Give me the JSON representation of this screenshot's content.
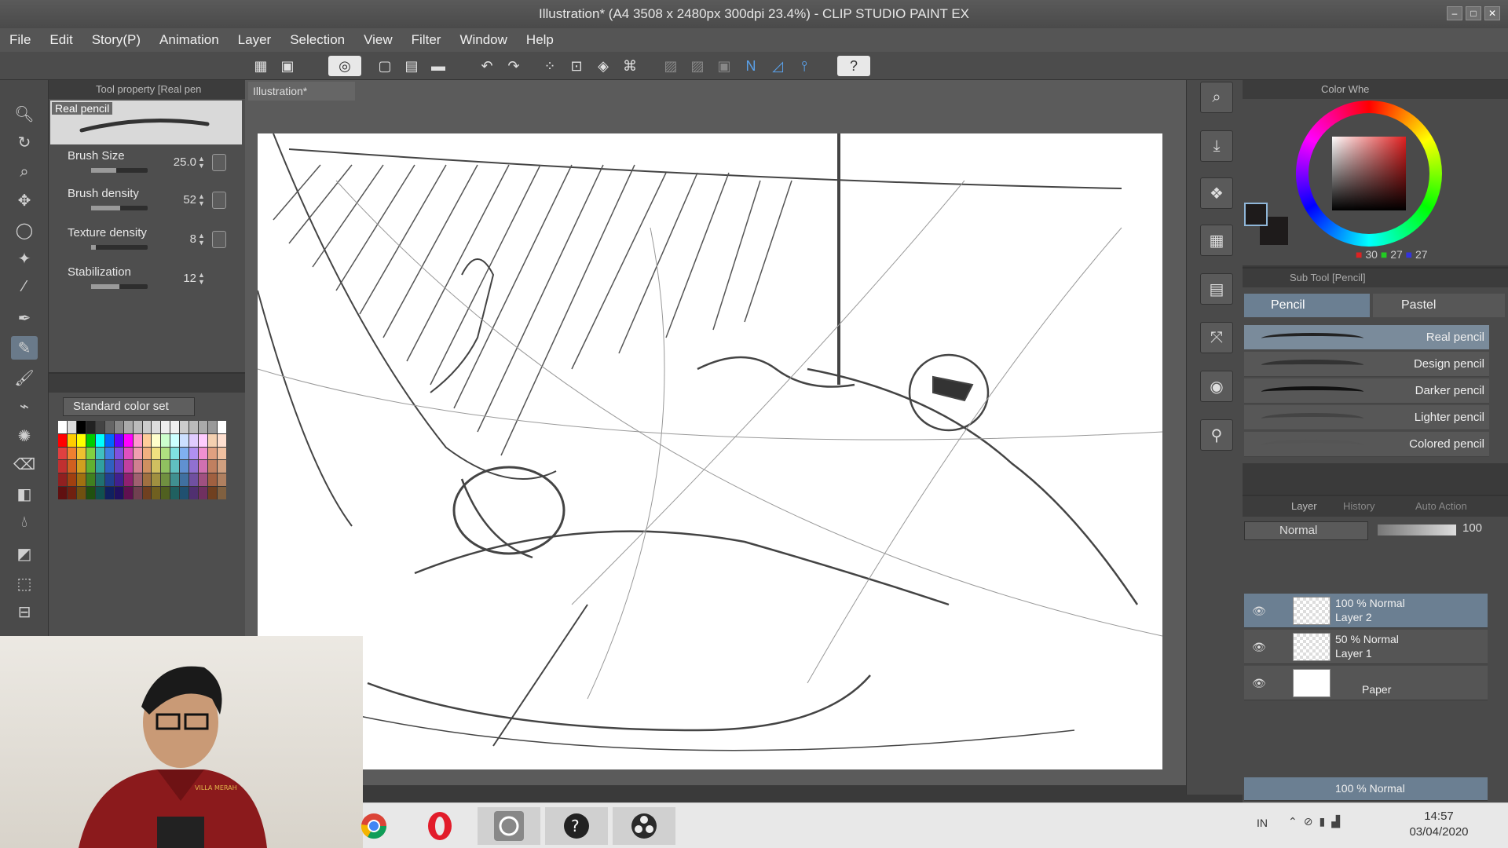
{
  "window": {
    "title": "Illustration* (A4 3508 x 2480px 300dpi 23.4%) - CLIP STUDIO PAINT EX"
  },
  "menu": [
    "File",
    "Edit",
    "Story(P)",
    "Animation",
    "Layer",
    "Selection",
    "View",
    "Filter",
    "Window",
    "Help"
  ],
  "tool_property": {
    "header": "Tool property [Real pen",
    "brush_name": "Real pencil",
    "props": [
      {
        "label": "Brush Size",
        "value": "25.0",
        "fill": 0.45
      },
      {
        "label": "Brush density",
        "value": "52",
        "fill": 0.52
      },
      {
        "label": "Texture density",
        "value": "8",
        "fill": 0.08
      },
      {
        "label": "Stabilization",
        "value": "12",
        "fill": 0.5
      }
    ]
  },
  "color_set": {
    "selected": "Standard color set"
  },
  "document": {
    "tab": "Illustration*"
  },
  "color_wheel": {
    "header": "Color Whe",
    "r": "30",
    "g": "27",
    "b": "27",
    "fg_color": "#1e1b1b"
  },
  "sub_tool": {
    "header": "Sub Tool [Pencil]",
    "tabs": [
      "Pencil",
      "Pastel"
    ],
    "brushes": [
      "Real pencil",
      "Design pencil",
      "Darker pencil",
      "Lighter pencil",
      "Colored pencil"
    ]
  },
  "layer_panel": {
    "tabs": [
      "Layer",
      "History",
      "Auto Action"
    ],
    "blend_mode": "Normal",
    "opacity": "100",
    "layers": [
      {
        "line1": "100 % Normal",
        "line2": "Layer 2",
        "selected": true
      },
      {
        "line1": "50 % Normal",
        "line2": "Layer 1",
        "selected": false
      },
      {
        "line1": "",
        "line2": "Paper",
        "selected": false
      }
    ],
    "bottom_row": "100 % Normal"
  },
  "taskbar": {
    "lang": "IN",
    "time": "14:57",
    "date": "03/04/2020"
  },
  "webcam": {
    "shirt_text": "VILLA MERAH"
  },
  "colors": {
    "accent": "#6b7f92",
    "panel": "#4a4a4a",
    "paper": "#ffffff"
  }
}
